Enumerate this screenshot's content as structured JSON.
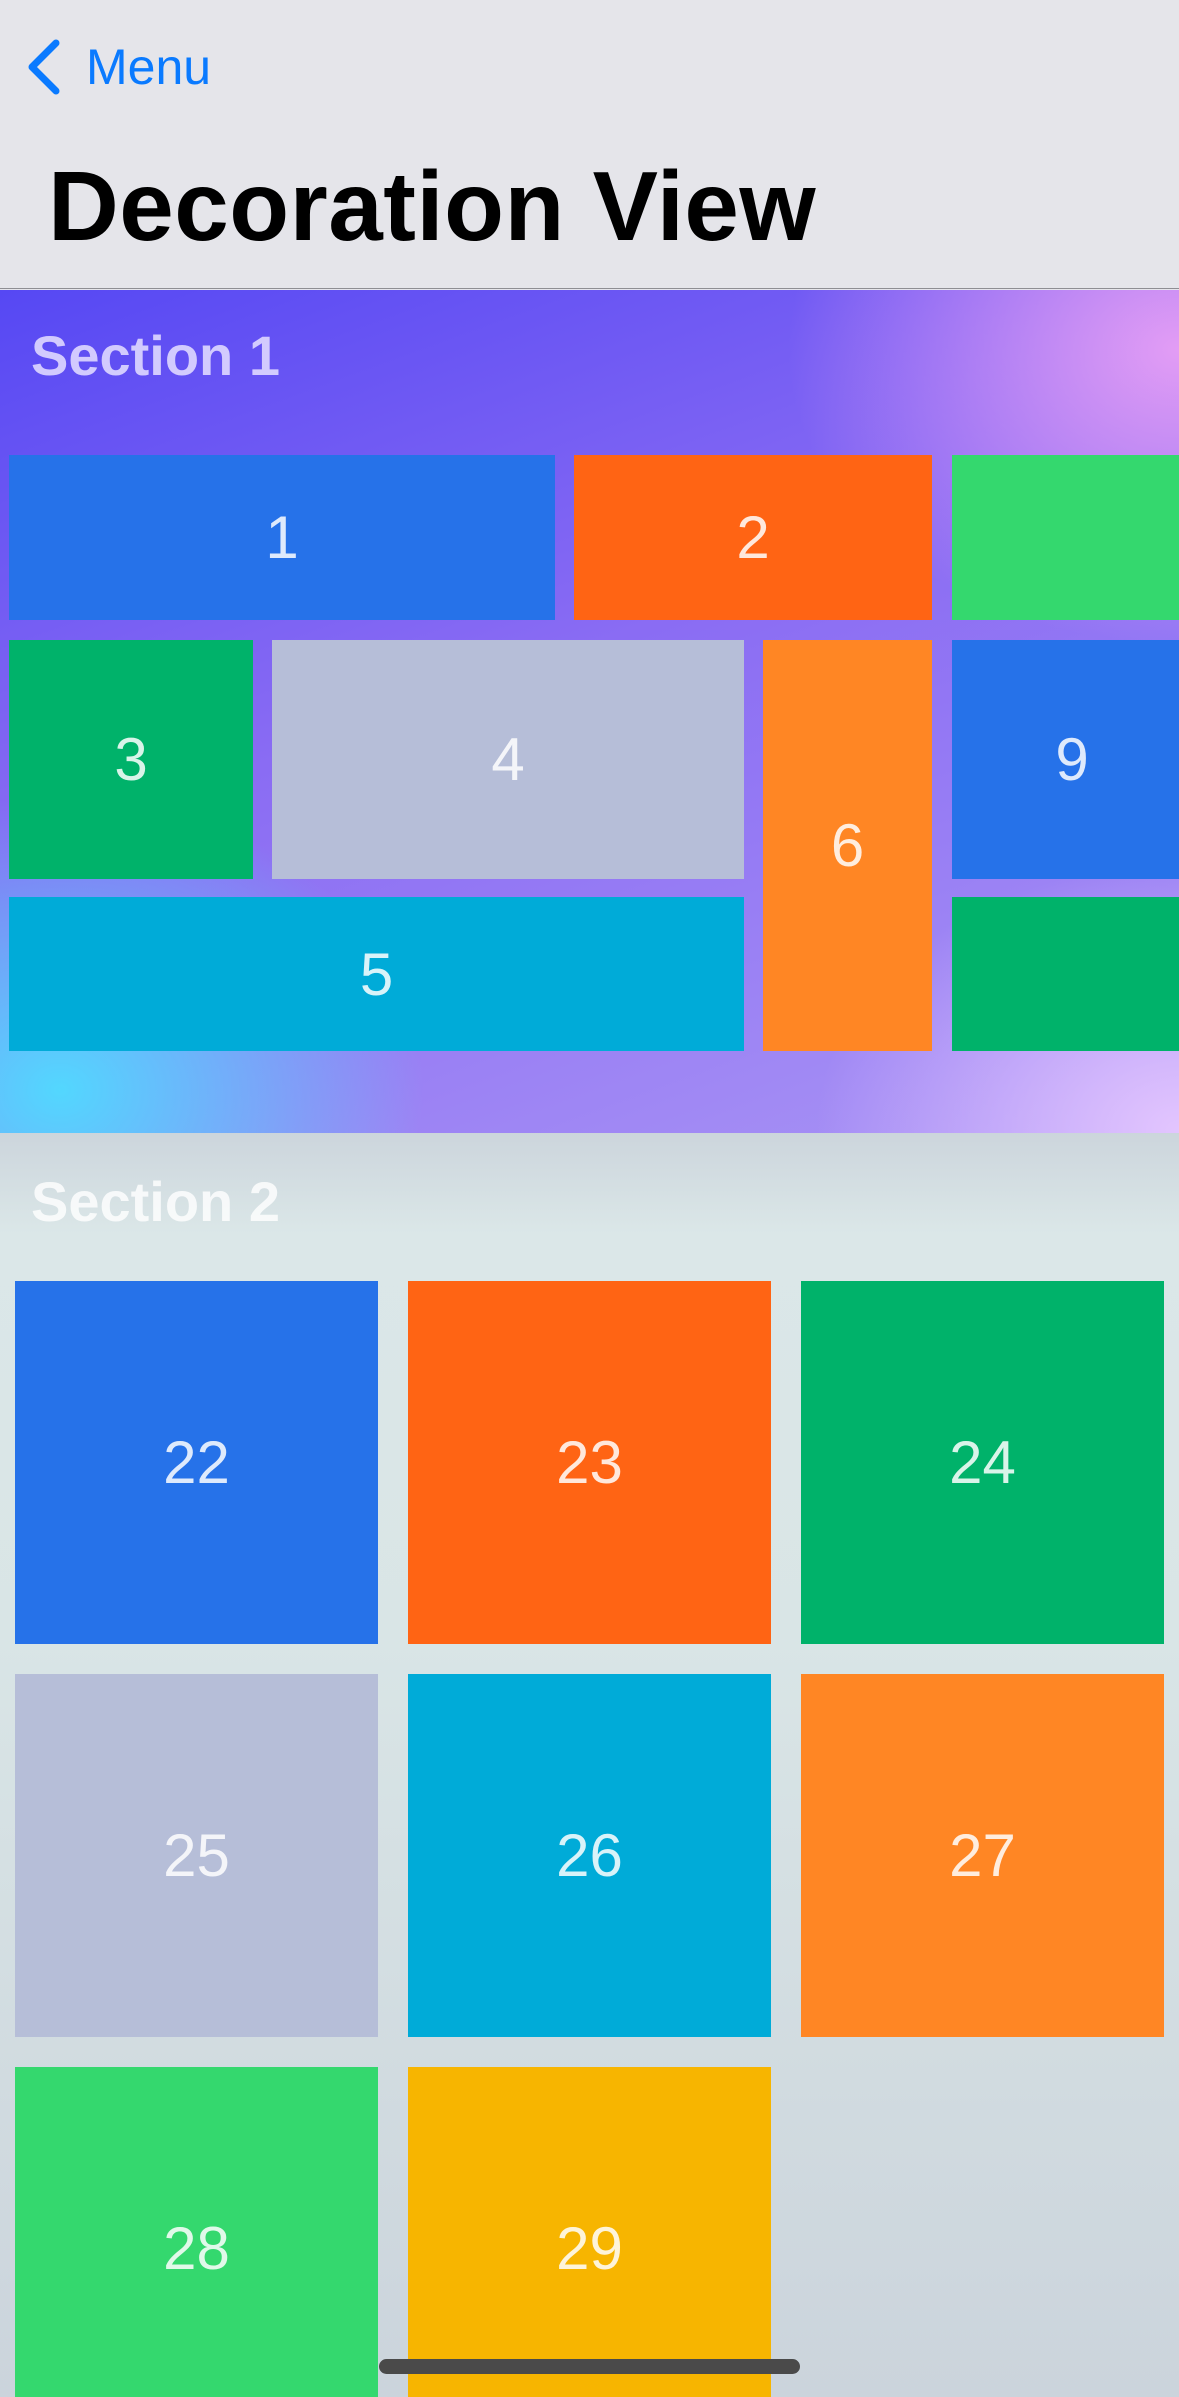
{
  "nav": {
    "back_label": "Menu",
    "title": "Decoration View"
  },
  "section1": {
    "label": "Section 1",
    "items": [
      {
        "label": "1",
        "color": "#2672e9"
      },
      {
        "label": "2",
        "color": "#ff6414"
      },
      {
        "label": "",
        "color": "#34d86e"
      },
      {
        "label": "3",
        "color": "#00b26a"
      },
      {
        "label": "4",
        "color": "#b6bed8"
      },
      {
        "label": "6",
        "color": "#ff8624"
      },
      {
        "label": "9",
        "color": "#2672e9"
      },
      {
        "label": "5",
        "color": "#00abd8"
      },
      {
        "label": "",
        "color": "#00b26a"
      }
    ]
  },
  "section2": {
    "label": "Section 2",
    "items": [
      {
        "label": "22",
        "color": "#2672e9"
      },
      {
        "label": "23",
        "color": "#ff6414"
      },
      {
        "label": "24",
        "color": "#00b26a"
      },
      {
        "label": "25",
        "color": "#b6bed8"
      },
      {
        "label": "26",
        "color": "#00abd8"
      },
      {
        "label": "27",
        "color": "#ff8624"
      },
      {
        "label": "28",
        "color": "#34d86e"
      },
      {
        "label": "29",
        "color": "#f7b500"
      }
    ]
  }
}
